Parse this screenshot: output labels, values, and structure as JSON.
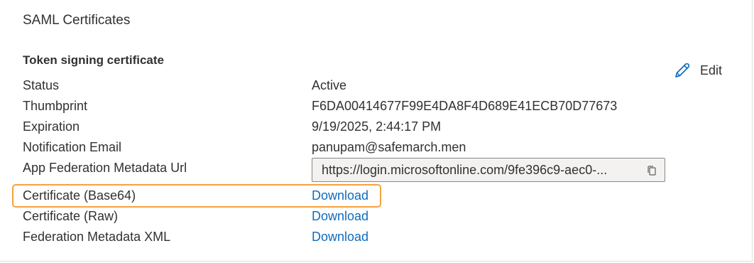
{
  "section": {
    "title": "SAML Certificates"
  },
  "certificate": {
    "title": "Token signing certificate",
    "edit_label": "Edit",
    "rows": {
      "status": {
        "label": "Status",
        "value": "Active"
      },
      "thumbprint": {
        "label": "Thumbprint",
        "value": "F6DA00414677F99E4DA8F4D689E41ECB70D77673"
      },
      "expiration": {
        "label": "Expiration",
        "value": "9/19/2025, 2:44:17 PM"
      },
      "notification_email": {
        "label": "Notification Email",
        "value": "panupam@safemarch.men"
      },
      "metadata_url": {
        "label": "App Federation Metadata Url",
        "value": "https://login.microsoftonline.com/9fe396c9-aec0-..."
      },
      "cert_base64": {
        "label": "Certificate (Base64)",
        "value": "Download"
      },
      "cert_raw": {
        "label": "Certificate (Raw)",
        "value": "Download"
      },
      "federation_xml": {
        "label": "Federation Metadata XML",
        "value": "Download"
      }
    }
  },
  "icons": {
    "edit": "pencil-icon",
    "copy": "copy-icon"
  },
  "colors": {
    "link": "#0f6cbd",
    "highlight": "#f5a33d",
    "text": "#323130",
    "field_bg": "#f3f2f1"
  }
}
